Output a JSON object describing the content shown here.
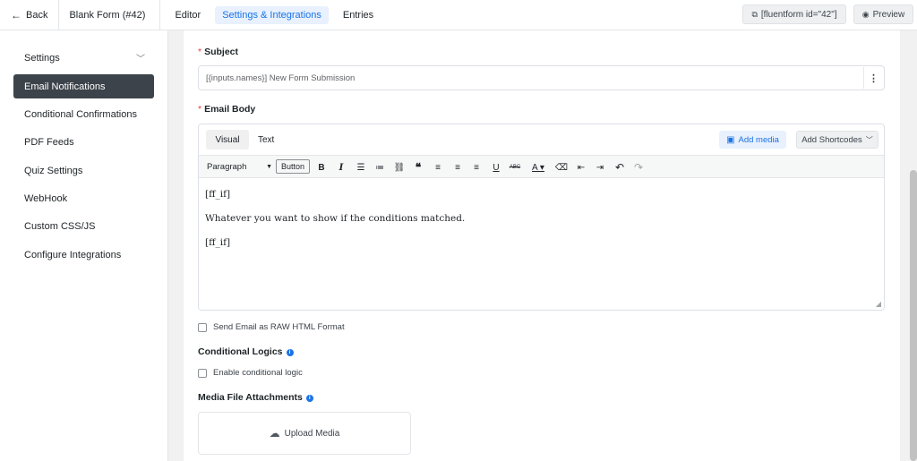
{
  "topbar": {
    "back_label": "Back",
    "form_title": "Blank Form (#42)",
    "tabs": [
      {
        "label": "Editor"
      },
      {
        "label": "Settings & Integrations"
      },
      {
        "label": "Entries"
      }
    ],
    "shortcode": "[fluentform id=\"42\"]",
    "preview_label": "Preview"
  },
  "sidebar": {
    "items": [
      {
        "label": "Settings"
      },
      {
        "label": "Email Notifications"
      },
      {
        "label": "Conditional Confirmations"
      },
      {
        "label": "PDF Feeds"
      },
      {
        "label": "Quiz Settings"
      },
      {
        "label": "WebHook"
      },
      {
        "label": "Custom CSS/JS"
      },
      {
        "label": "Configure Integrations"
      }
    ]
  },
  "form": {
    "subject_label": "Subject",
    "subject_value": "[{inputs.names}] New Form Submission",
    "email_body_label": "Email Body",
    "editor": {
      "tab_visual": "Visual",
      "tab_text": "Text",
      "add_media": "Add media",
      "add_shortcodes": "Add Shortcodes",
      "paragraph": "Paragraph",
      "button_label": "Button",
      "body_lines": [
        "[ff_if]",
        "Whatever you want to show if the conditions matched.",
        "[ff_if]"
      ]
    },
    "raw_html_label": "Send Email as RAW HTML Format",
    "conditional_logics_label": "Conditional Logics",
    "enable_conditional_label": "Enable conditional logic",
    "media_attachments_label": "Media File Attachments",
    "upload_media_label": "Upload Media"
  },
  "colors": {
    "accent": "#1a73e8",
    "active_sidebar": "#3c434a",
    "required": "#e53e3e"
  }
}
